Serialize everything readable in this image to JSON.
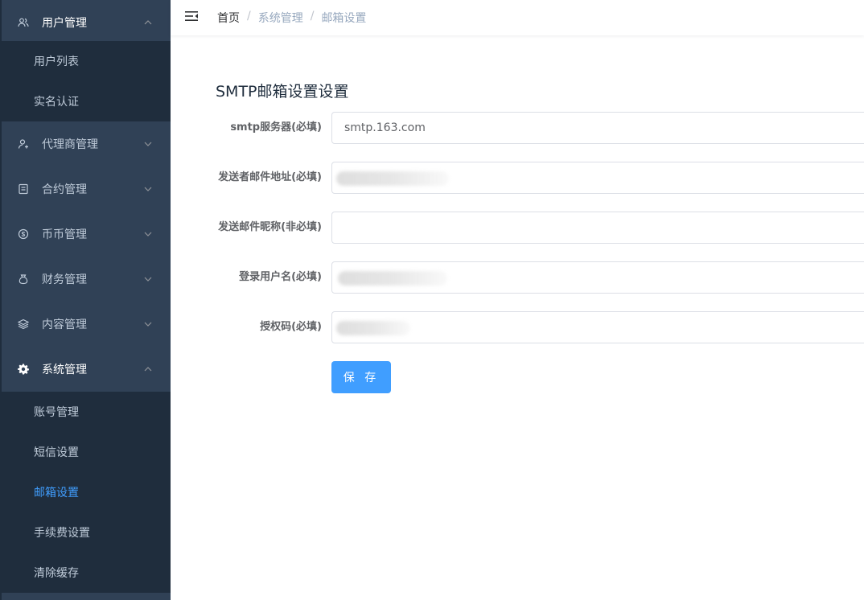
{
  "sidebar": {
    "groups": [
      {
        "label": "用户管理",
        "icon": "users-icon",
        "expanded": true,
        "children": [
          "用户列表",
          "实名认证"
        ]
      },
      {
        "label": "代理商管理",
        "icon": "agent-icon",
        "expanded": false
      },
      {
        "label": "合约管理",
        "icon": "contract-icon",
        "expanded": false
      },
      {
        "label": "币币管理",
        "icon": "coin-icon",
        "expanded": false
      },
      {
        "label": "财务管理",
        "icon": "finance-icon",
        "expanded": false
      },
      {
        "label": "内容管理",
        "icon": "layers-icon",
        "expanded": false
      },
      {
        "label": "系统管理",
        "icon": "gear-icon",
        "expanded": true,
        "children": [
          "账号管理",
          "短信设置",
          "邮箱设置",
          "手续费设置",
          "清除缓存"
        ]
      }
    ],
    "active_item": "邮箱设置"
  },
  "navbar": {
    "breadcrumb": [
      "首页",
      "系统管理",
      "邮箱设置"
    ],
    "separator": "/"
  },
  "form": {
    "title": "SMTP邮箱设置设置",
    "fields": [
      {
        "label": "smtp服务器(必填)",
        "value": "smtp.163.com"
      },
      {
        "label": "发送者邮件地址(必填)",
        "value": ""
      },
      {
        "label": "发送邮件昵称(非必填)",
        "value": ""
      },
      {
        "label": "登录用户名(必填)",
        "value": ""
      },
      {
        "label": "授权码(必填)",
        "value": ""
      }
    ],
    "save_label": "保 存"
  },
  "colors": {
    "sidebar_bg": "#304156",
    "submenu_bg": "#1f2d3d",
    "menu_text": "#bfcbd9",
    "active": "#409eff",
    "button": "#409eff"
  }
}
